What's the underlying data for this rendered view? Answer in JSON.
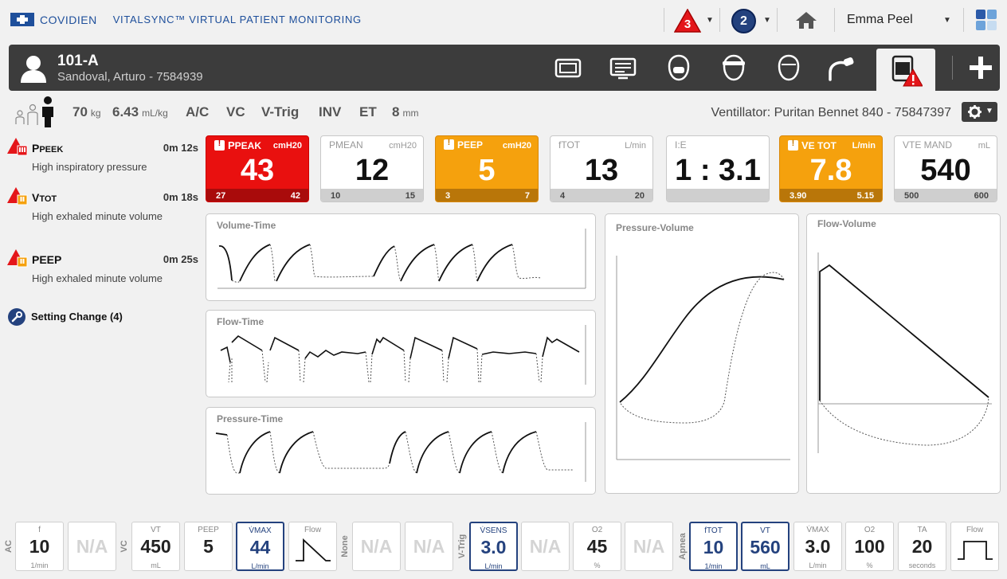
{
  "header": {
    "brand": "COVIDIEN",
    "app_title": "VITALSYNC™ VIRTUAL PATIENT MONITORING",
    "alarm_count": "3",
    "notification_count": "2",
    "user": "Emma Peel"
  },
  "patient": {
    "bed": "101-A",
    "name": "Sandoval, Arturo - 7584939"
  },
  "settings": {
    "weight_value": "70",
    "weight_unit": "kg",
    "ratio_value": "6.43",
    "ratio_unit": "mL/kg",
    "mode": "A/C",
    "control": "VC",
    "trigger": "V-Trig",
    "interface": "INV",
    "tube": "ET",
    "tube_size_value": "8",
    "tube_size_unit": "mm",
    "ventilator": "Ventillator: Puritan Bennet 840 - 75847397"
  },
  "alarms": [
    {
      "title": "PPEEK",
      "title_main": "P",
      "title_sub": "PEEK",
      "time": "0m 12s",
      "desc": "High inspiratory pressure"
    },
    {
      "title": "VTOT",
      "title_main": "V",
      "title_sub": "TOT",
      "time": "0m 18s",
      "desc": "High exhaled minute volume"
    },
    {
      "title": "PEEP",
      "title_main": "PEEP",
      "title_sub": "",
      "time": "0m 25s",
      "desc": "High exhaled minute volume"
    }
  ],
  "setting_change": "Setting Change (4)",
  "tiles": [
    {
      "name_main": "P",
      "name_sub": "PEAK",
      "unit": "cmH20",
      "value": "43",
      "low": "27",
      "high": "42",
      "state": "red"
    },
    {
      "name_main": "P",
      "name_sub": "MEAN",
      "unit": "cmH20",
      "value": "12",
      "low": "10",
      "high": "15",
      "state": "normal"
    },
    {
      "name_main": "PEEP",
      "name_sub": "",
      "unit": "cmH20",
      "value": "5",
      "low": "3",
      "high": "7",
      "state": "orange"
    },
    {
      "name_main": "f",
      "name_sub": "TOT",
      "unit": "L/min",
      "value": "13",
      "low": "4",
      "high": "20",
      "state": "normal"
    },
    {
      "name_main": "I:E",
      "name_sub": "",
      "unit": "",
      "value": "1 : 3.1",
      "low": "",
      "high": "",
      "state": "normal"
    },
    {
      "name_main": "V",
      "name_sub": "E TOT",
      "unit": "L/min",
      "value": "7.8",
      "low": "3.90",
      "high": "5.15",
      "state": "orange"
    },
    {
      "name_main": "V",
      "name_sub": "TE MAND",
      "unit": "mL",
      "value": "540",
      "low": "500",
      "high": "600",
      "state": "normal"
    }
  ],
  "graphs": {
    "volume_time": "Volume-Time",
    "flow_time": "Flow-Time",
    "pressure_time": "Pressure-Time",
    "pressure_volume": "Pressure-Volume",
    "flow_volume": "Flow-Volume"
  },
  "bottom": {
    "modes": [
      "AC",
      "VC",
      "None",
      "V-Trig",
      "Apnea"
    ],
    "tiles": [
      {
        "name": "f",
        "value": "10",
        "unit": "1/min",
        "state": "normal"
      },
      {
        "name": "",
        "value": "N/A",
        "unit": "",
        "state": "na"
      },
      {
        "name": "VT",
        "value": "450",
        "unit": "mL",
        "state": "normal"
      },
      {
        "name": "PEEP",
        "value": "5",
        "unit": "",
        "state": "normal"
      },
      {
        "name": "V̇MAX",
        "value": "44",
        "unit": "L/min",
        "state": "hl"
      },
      {
        "name": "Flow",
        "value": "",
        "unit": "",
        "state": "normal"
      },
      {
        "name": "",
        "value": "N/A",
        "unit": "",
        "state": "na"
      },
      {
        "name": "",
        "value": "N/A",
        "unit": "",
        "state": "na"
      },
      {
        "name": "V̇SENS",
        "value": "3.0",
        "unit": "L/min",
        "state": "hl"
      },
      {
        "name": "",
        "value": "N/A",
        "unit": "",
        "state": "na"
      },
      {
        "name": "O2",
        "value": "45",
        "unit": "%",
        "state": "normal"
      },
      {
        "name": "",
        "value": "N/A",
        "unit": "",
        "state": "na"
      },
      {
        "name": "fTOT",
        "value": "10",
        "unit": "1/min",
        "state": "hl"
      },
      {
        "name": "VT",
        "value": "560",
        "unit": "mL",
        "state": "hl"
      },
      {
        "name": "V̇MAX",
        "value": "3.0",
        "unit": "L/min",
        "state": "normal"
      },
      {
        "name": "O2",
        "value": "100",
        "unit": "%",
        "state": "normal"
      },
      {
        "name": "TA",
        "value": "20",
        "unit": "seconds",
        "state": "normal"
      },
      {
        "name": "Flow",
        "value": "",
        "unit": "",
        "state": "normal"
      }
    ]
  }
}
